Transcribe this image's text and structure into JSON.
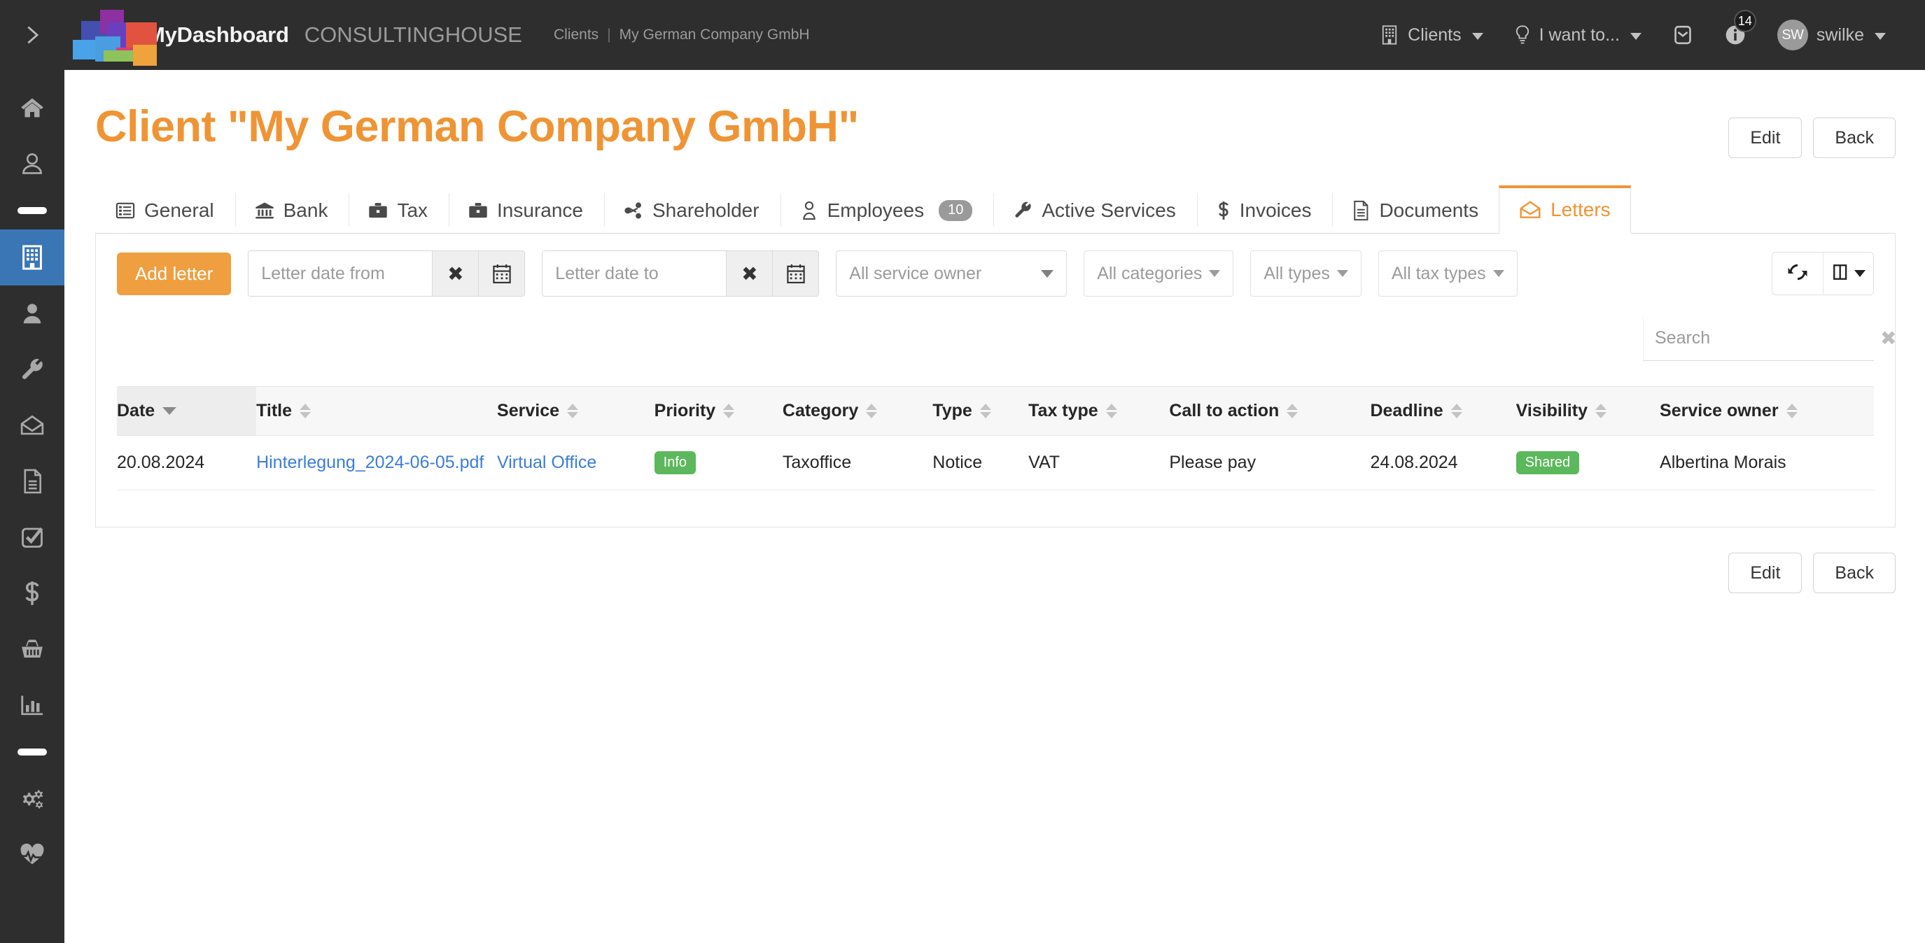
{
  "topbar": {
    "expand_icon": "chevron-right-icon",
    "brand": "MyDashboard",
    "brand_sub": "CONSULTINGHOUSE",
    "breadcrumb": {
      "root": "Clients",
      "separator": "|",
      "current": "My German Company GmbH"
    },
    "clients_menu": "Clients",
    "iwant_menu": "I want to...",
    "mail_icon": "envelope-icon",
    "info_icon": "info-circle-icon",
    "info_badge": "14",
    "avatar_initials": "SW",
    "username": "swilke"
  },
  "sidebar": {
    "items": [
      {
        "name": "home",
        "icon": "home-icon",
        "active": false
      },
      {
        "name": "profile",
        "icon": "user-circle-icon",
        "active": false
      },
      {
        "name": "separator-1",
        "icon": "separator",
        "active": false
      },
      {
        "name": "clients",
        "icon": "building-icon",
        "active": true
      },
      {
        "name": "contacts",
        "icon": "user-solid-icon",
        "active": false
      },
      {
        "name": "services",
        "icon": "wrench-icon",
        "active": false
      },
      {
        "name": "letters",
        "icon": "envelope-open-icon",
        "active": false
      },
      {
        "name": "documents",
        "icon": "document-icon",
        "active": false
      },
      {
        "name": "tasks",
        "icon": "check-square-icon",
        "active": false
      },
      {
        "name": "invoices",
        "icon": "dollar-icon",
        "active": false
      },
      {
        "name": "shop",
        "icon": "basket-icon",
        "active": false
      },
      {
        "name": "reports",
        "icon": "bar-chart-icon",
        "active": false
      },
      {
        "name": "separator-2",
        "icon": "separator",
        "active": false
      },
      {
        "name": "settings",
        "icon": "gears-icon",
        "active": false
      },
      {
        "name": "health",
        "icon": "heartbeat-icon",
        "active": false
      }
    ]
  },
  "page": {
    "title": "Client \"My German Company GmbH\"",
    "edit_label": "Edit",
    "back_label": "Back"
  },
  "tabs": [
    {
      "label": "General",
      "icon": "list-alt-icon",
      "active": false,
      "badge": null
    },
    {
      "label": "Bank",
      "icon": "bank-icon",
      "active": false,
      "badge": null
    },
    {
      "label": "Tax",
      "icon": "briefcase-icon",
      "active": false,
      "badge": null
    },
    {
      "label": "Insurance",
      "icon": "briefcase-icon",
      "active": false,
      "badge": null
    },
    {
      "label": "Shareholder",
      "icon": "share-alt-icon",
      "active": false,
      "badge": null
    },
    {
      "label": "Employees",
      "icon": "user-outline-icon",
      "active": false,
      "badge": "10"
    },
    {
      "label": "Active Services",
      "icon": "wrench-icon",
      "active": false,
      "badge": null
    },
    {
      "label": "Invoices",
      "icon": "dollar-icon",
      "active": false,
      "badge": null
    },
    {
      "label": "Documents",
      "icon": "file-text-icon",
      "active": false,
      "badge": null
    },
    {
      "label": "Letters",
      "icon": "envelope-open-icon",
      "active": true,
      "badge": null
    }
  ],
  "toolbar": {
    "add_letter_label": "Add letter",
    "date_from_placeholder": "Letter date from",
    "date_from_value": "",
    "date_to_placeholder": "Letter date to",
    "date_to_value": "",
    "clear_icon": "x-icon",
    "calendar_icon": "calendar-icon",
    "service_owner_select": "All service owner",
    "categories_select": "All categories",
    "types_select": "All types",
    "tax_types_select": "All tax types",
    "refresh_icon": "refresh-icon",
    "columns_icon": "columns-icon"
  },
  "search": {
    "placeholder": "Search",
    "value": "",
    "clear_icon": "x-icon"
  },
  "table": {
    "columns": [
      {
        "label": "Date",
        "sort": "desc"
      },
      {
        "label": "Title",
        "sort": "none"
      },
      {
        "label": "Service",
        "sort": "none"
      },
      {
        "label": "Priority",
        "sort": "none"
      },
      {
        "label": "Category",
        "sort": "none"
      },
      {
        "label": "Type",
        "sort": "none"
      },
      {
        "label": "Tax type",
        "sort": "none"
      },
      {
        "label": "Call to action",
        "sort": "none"
      },
      {
        "label": "Deadline",
        "sort": "none"
      },
      {
        "label": "Visibility",
        "sort": "none"
      },
      {
        "label": "Service owner",
        "sort": "none"
      }
    ],
    "rows": [
      {
        "date": "20.08.2024",
        "title": "Hinterlegung_2024-06-05.pdf",
        "service": "Virtual Office",
        "priority": "Info",
        "category": "Taxoffice",
        "type": "Notice",
        "tax_type": "VAT",
        "call_to_action": "Please pay",
        "deadline": "24.08.2024",
        "visibility": "Shared",
        "service_owner": "Albertina Morais"
      }
    ]
  },
  "footer": {
    "edit_label": "Edit",
    "back_label": "Back"
  },
  "colors": {
    "accent_orange": "#ef9434",
    "link_blue": "#3b7dd8",
    "green_badge": "#5cb85c",
    "sidebar_dark": "#2e2e2e",
    "sidebar_active": "#3a76b5"
  }
}
